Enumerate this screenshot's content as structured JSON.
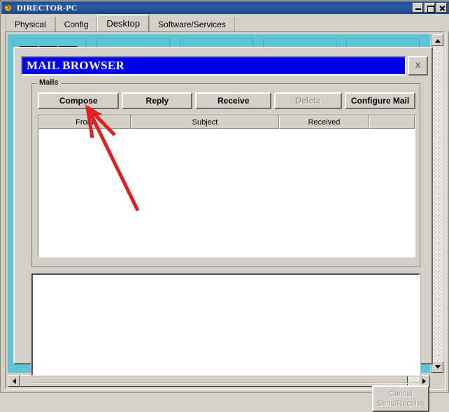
{
  "window": {
    "title": "DIRECTOR-PC",
    "icon": "packet-tracer-icon",
    "controls": {
      "minimize": "_",
      "maximize": "□",
      "close": "X"
    }
  },
  "tabs": [
    {
      "label": "Physical",
      "active": false
    },
    {
      "label": "Config",
      "active": false
    },
    {
      "label": "Desktop",
      "active": true
    },
    {
      "label": "Software/Services",
      "active": false
    }
  ],
  "desktop": {
    "background_color": "#5ec4d8",
    "icons": [
      {
        "name": "command-prompt-icon"
      },
      {
        "name": "text-editor-icon"
      },
      {
        "name": "window-icon"
      },
      {
        "name": "monitor-icon"
      },
      {
        "name": "web-browser-icon"
      }
    ],
    "scrollbars": {
      "vertical": {
        "up": "▲",
        "down": "▼"
      },
      "horizontal": {
        "left": "◀",
        "right": "▶"
      }
    }
  },
  "dialog": {
    "title": "MAIL BROWSER",
    "close_label": "X",
    "title_bg": "#0000ee",
    "title_fg": "#ffffff",
    "group_legend": "Mails",
    "buttons": [
      {
        "label": "Compose",
        "enabled": true,
        "key": "compose"
      },
      {
        "label": "Reply",
        "enabled": true,
        "key": "reply"
      },
      {
        "label": "Receive",
        "enabled": true,
        "key": "receive"
      },
      {
        "label": "Delete",
        "enabled": false,
        "key": "delete"
      },
      {
        "label": "Configure Mail",
        "enabled": true,
        "key": "configure-mail"
      }
    ],
    "table": {
      "columns": [
        "From",
        "Subject",
        "Received",
        ""
      ],
      "rows": []
    },
    "preview": {
      "text": ""
    },
    "cancel_button": {
      "line1": "Cancel",
      "line2": "Send/Receive",
      "enabled": false
    }
  },
  "annotation": {
    "color": "#e02020",
    "type": "arrow",
    "points_to": "compose-button"
  }
}
